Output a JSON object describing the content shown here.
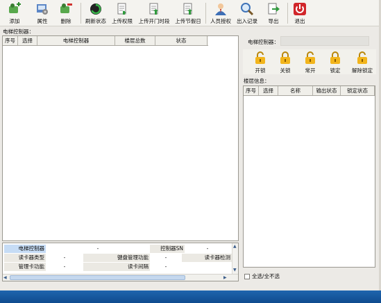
{
  "toolbar": {
    "buttons": [
      {
        "label": "添加",
        "icon": "add-user-icon"
      },
      {
        "label": "属性",
        "icon": "properties-icon"
      },
      {
        "label": "删除",
        "icon": "delete-user-icon"
      },
      {
        "label": "刷新状态",
        "icon": "refresh-icon"
      },
      {
        "label": "上传权限",
        "icon": "upload-doc-icon"
      },
      {
        "label": "上传开门时段",
        "icon": "upload-doc-icon"
      },
      {
        "label": "上传节假日",
        "icon": "upload-doc-icon"
      },
      {
        "label": "人员授权",
        "icon": "person-icon"
      },
      {
        "label": "出入记录",
        "icon": "magnifier-icon"
      },
      {
        "label": "导出",
        "icon": "export-icon"
      },
      {
        "label": "退出",
        "icon": "power-icon"
      }
    ]
  },
  "left": {
    "title": "电梯控制器：",
    "columns": [
      "序号",
      "选择",
      "电梯控制器",
      "楼层总数",
      "状态"
    ]
  },
  "grid": {
    "row1": {
      "label1": "电梯控制器",
      "value1": "-",
      "label2": "控制器SN",
      "value2": "-"
    },
    "row2": {
      "label1": "读卡器类型",
      "value1": "-",
      "label2": "键盘管理功能",
      "value2": "-",
      "label3": "读卡器检测"
    },
    "row3": {
      "label1": "管理卡功能",
      "value1": "-",
      "label2": "读卡间隔",
      "value2": "-"
    }
  },
  "right": {
    "controller_label": "电梯控制器：",
    "controller_value": "",
    "lock_buttons": [
      {
        "label": "开锁",
        "icon": "unlock-icon"
      },
      {
        "label": "关锁",
        "icon": "lock-icon"
      },
      {
        "label": "常开",
        "icon": "unlock-icon"
      },
      {
        "label": "锁定",
        "icon": "lock-icon"
      },
      {
        "label": "解除锁定",
        "icon": "unlock-icon"
      }
    ],
    "floor_title": "楼层信息：",
    "columns": [
      "序号",
      "选择",
      "名称",
      "输出状态",
      "锁定状态"
    ],
    "select_all_label": "全选/全不选"
  },
  "colors": {
    "accent": "#1f65ae",
    "grid_selected": "#c6dcf5",
    "lock_gold": "#f2b51c"
  }
}
